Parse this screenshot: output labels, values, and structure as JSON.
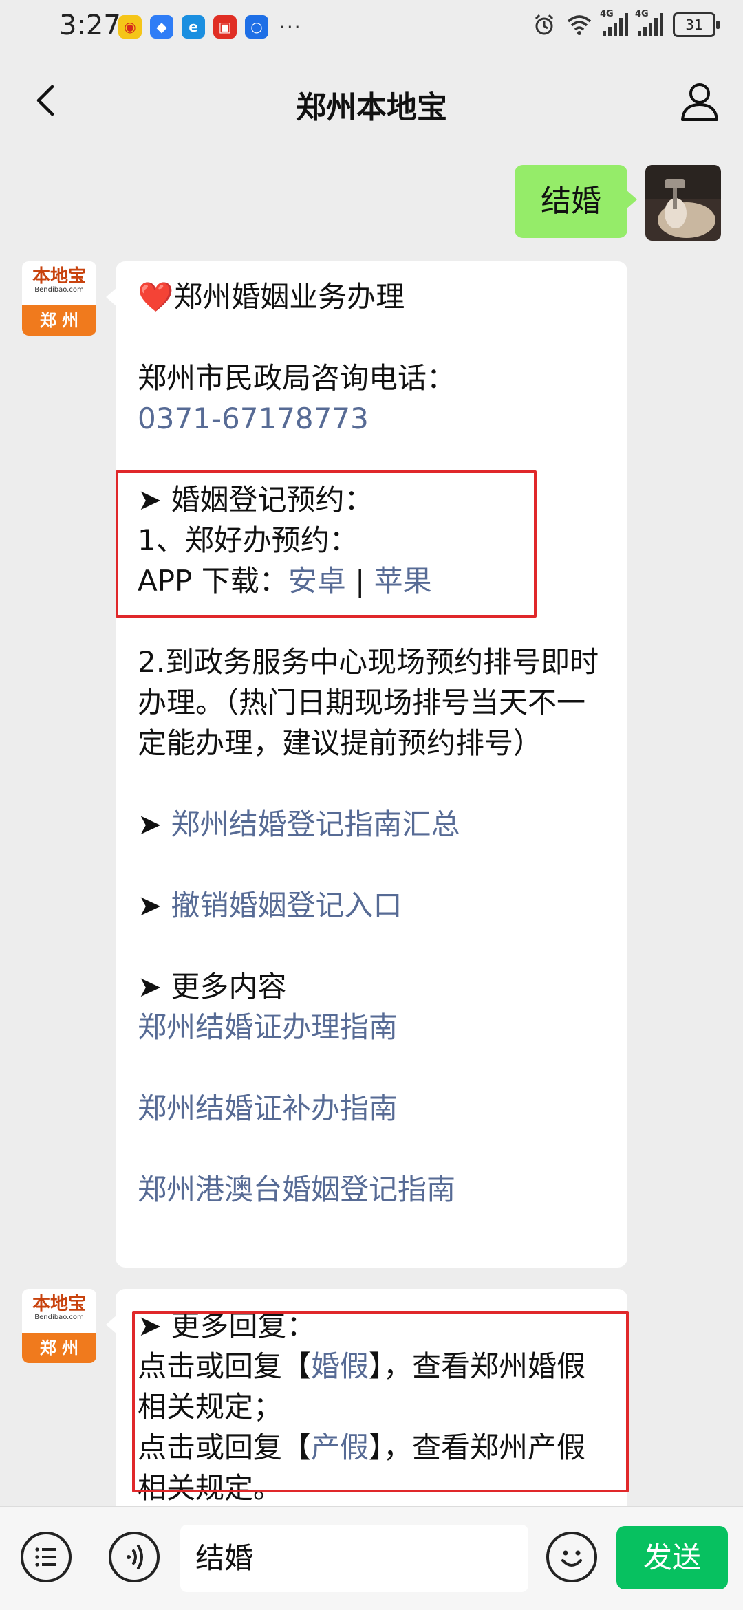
{
  "status_bar": {
    "time": "3:27",
    "more": "···",
    "network_1": "4G",
    "network_2": "4G",
    "battery": "31"
  },
  "nav": {
    "title": "郑州本地宝"
  },
  "chat": {
    "outgoing": {
      "text": "结婚"
    },
    "bot_avatar": {
      "logo_text": "本地宝",
      "logo_domain": "Bendibao.com",
      "city": "郑 州"
    },
    "message1": {
      "heading": "❤️郑州婚姻业务办理",
      "phone_label": "郑州市民政局咨询电话：",
      "phone": "0371-67178773",
      "booking_heading": "➤ 婚姻登记预约：",
      "booking_item1": "1、郑好办预约：",
      "app_label": "APP 下载：",
      "app_android": "安卓",
      "app_sep": " | ",
      "app_ios": "苹果",
      "booking_item2": "2.到政务服务中心现场预约排号即时办理。（热门日期现场排号当天不一定能办理，建议提前预约排号）",
      "arrow": "➤ ",
      "guide_link": "郑州结婚登记指南汇总",
      "cancel_link": "撤销婚姻登记入口",
      "more_heading": "➤ 更多内容",
      "more_link1": "郑州结婚证办理指南",
      "more_link2": "郑州结婚证补办指南",
      "more_link3": "郑州港澳台婚姻登记指南"
    },
    "message2": {
      "heading": "➤ 更多回复：",
      "line1_pre": "点击或回复【",
      "line1_link": "婚假",
      "line1_post": "】，查看郑州婚假相关规定；",
      "line2_pre": "点击或回复【",
      "line2_link": "产假",
      "line2_post": "】，查看郑州产假相关规定。"
    }
  },
  "input_bar": {
    "input_value": "结婚",
    "send_label": "发送"
  },
  "colors": {
    "link": "#576b95",
    "send_button": "#07c160",
    "outgoing_bubble": "#95ec69",
    "highlight_box": "#e0282a"
  }
}
